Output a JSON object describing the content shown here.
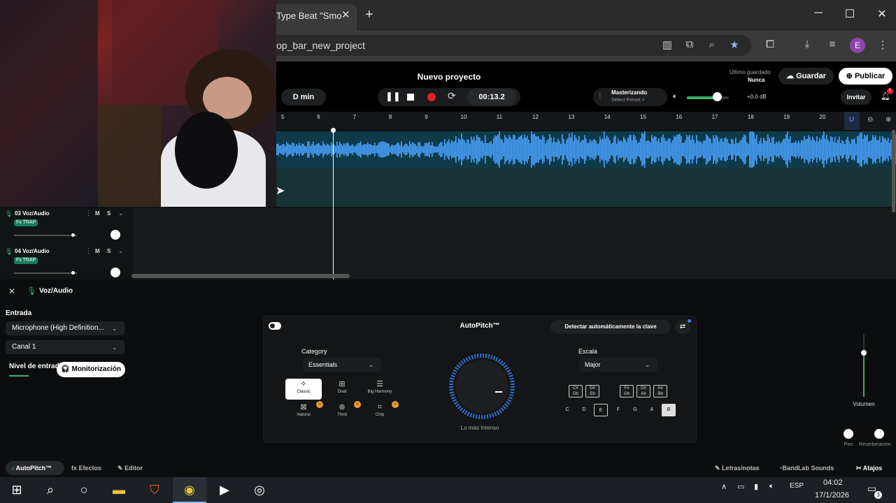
{
  "browser": {
    "tab_title": "Type Beat \"Smo",
    "url": "op_bar_new_project",
    "profile_initial": "E"
  },
  "header": {
    "project_title": "Nuevo proyecto",
    "tempo": "D min",
    "time": "00:13.2",
    "mastering_label": "Masterizando",
    "mastering_preset": "Select Preset >",
    "volume_level": 0.72,
    "db": "+0.0 dB",
    "last_saved_label": "Último guardado",
    "last_saved_value": "Nunca",
    "save": "Guardar",
    "publish": "Publicar",
    "invite": "Invitar",
    "notif_count": "1"
  },
  "ruler": {
    "ticks": [
      "5",
      "6",
      "7",
      "8",
      "9",
      "10",
      "11",
      "12",
      "13",
      "14",
      "15",
      "16",
      "17",
      "18",
      "19",
      "20"
    ]
  },
  "tracks": [
    {
      "name": "03  Voz/Audio",
      "fx": "Fx TRAP",
      "m": "M",
      "s": "S"
    },
    {
      "name": "04  Voz/Audio",
      "fx": "Fx TRAP",
      "m": "M",
      "s": "S"
    }
  ],
  "voice_panel": {
    "track_name": "Voz/Audio",
    "input_label": "Entrada",
    "input_device": "Microphone (High Definition...",
    "channel": "Canal 1",
    "level_label": "Nivel de entrada",
    "monitor": "Monitorización"
  },
  "autopitch": {
    "title": "AutoPitch™",
    "detect": "Detectar automáticamente la clave",
    "category_label": "Category",
    "category_value": "Essentials",
    "styles": [
      "Classic",
      "Duet",
      "Big Harmony",
      "Natural",
      "Third",
      "Chip"
    ],
    "intensity_label": "Lo más Intenso",
    "scale_label": "Escala",
    "scale_value": "Major",
    "sharp_keys": [
      "C#\nDb",
      "D#\nEb",
      "F#\nGb",
      "G#\nAb",
      "A#\nBb"
    ],
    "keys": [
      "C",
      "D",
      "E",
      "F",
      "G",
      "A",
      "B"
    ],
    "volume_label": "Volumen",
    "pan_label": "Pan",
    "reverb_label": "Reverberación"
  },
  "bottom_tabs": {
    "autopitch": "AutoPitch™",
    "effects": "Efectos",
    "editor": "Editor",
    "lyrics": "Letras/notas",
    "sounds": "BandLab Sounds",
    "shortcuts": "Atajos"
  },
  "taskbar": {
    "lang": "ESP",
    "time": "04:02",
    "date": "17/1/2026",
    "notif": "3"
  },
  "colors": {
    "accent": "#3ab06a",
    "waveform": "#4aa3ff",
    "record": "#e0202a"
  }
}
